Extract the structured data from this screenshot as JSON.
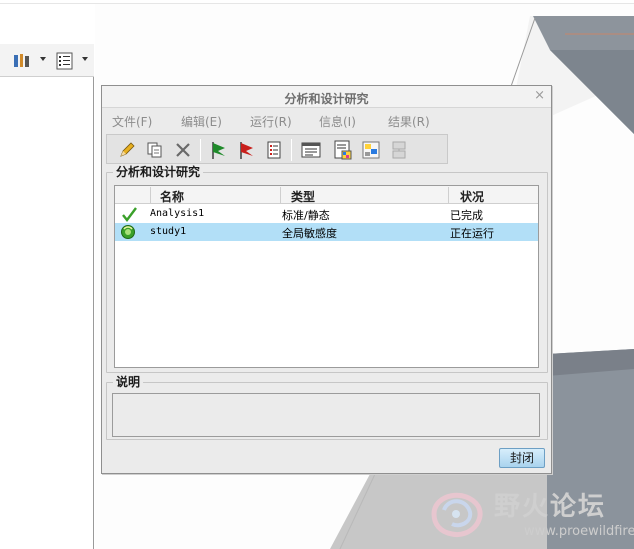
{
  "dialog": {
    "title": "分析和设计研究",
    "close_glyph": "×",
    "menus": [
      "文件(F)",
      "编辑(E)",
      "运行(R)",
      "信息(I)",
      "结果(R)"
    ],
    "toolbar_icons": [
      "edit-icon",
      "copy-icon",
      "delete-icon",
      "start-flag-icon",
      "stop-flag-icon",
      "status-list-icon",
      "summary-icon",
      "display-results-icon",
      "config-icon",
      "report-icon"
    ],
    "studies_group_label": "分析和设计研究",
    "columns": [
      "名称",
      "类型",
      "状况"
    ],
    "rows": [
      {
        "name": "Analysis1",
        "type": "标准/静态",
        "status": "已完成",
        "state_icon": "checkmark-icon"
      },
      {
        "name": "study1",
        "type": "全局敏感度",
        "status": "正在运行",
        "state_icon": "running-icon"
      }
    ],
    "selected_row": 1,
    "description_label": "说明",
    "description_value": "",
    "close_button": "封闭"
  },
  "watermark": {
    "text": "野火论坛",
    "url": "www.proewildfire.cn"
  },
  "colors": {
    "selection": "#b2dff7",
    "check": "#3aa02a",
    "flag_green": "#1f8a2a",
    "flag_red": "#c8201c",
    "model_gray": "#8b939c"
  }
}
